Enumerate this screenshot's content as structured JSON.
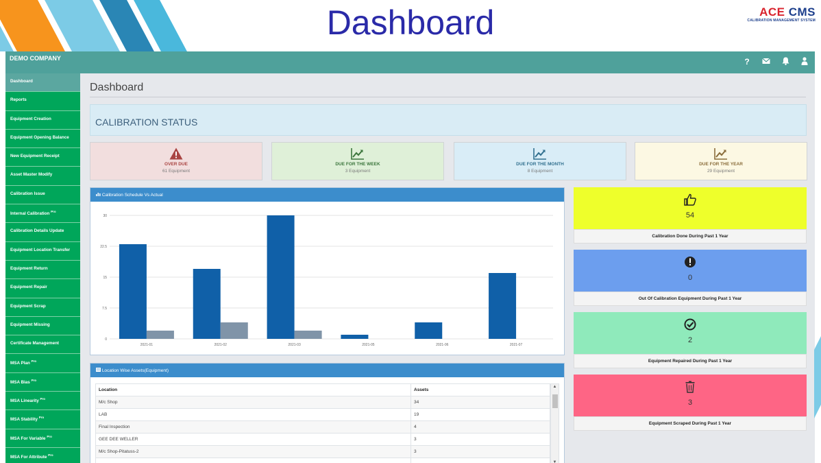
{
  "banner": {
    "title": "Dashboard",
    "logo_ace": "ACE",
    "logo_cms": "CMS",
    "logo_sub": "CALIBRATION MANAGEMENT SYSTEM"
  },
  "topbar": {
    "company": "DEMO COMPANY",
    "icons": [
      "help-icon",
      "mail-icon",
      "bell-icon",
      "user-icon"
    ],
    "help_glyph": "?"
  },
  "sidebar": {
    "items": [
      {
        "label": "Dashboard",
        "pro": ""
      },
      {
        "label": "Reports",
        "pro": ""
      },
      {
        "label": "Equipment Creation",
        "pro": ""
      },
      {
        "label": "Equipment Opening Balance",
        "pro": ""
      },
      {
        "label": "New Equipment Receipt",
        "pro": ""
      },
      {
        "label": "Asset Master Modify",
        "pro": ""
      },
      {
        "label": "Calibration Issue",
        "pro": ""
      },
      {
        "label": "Internal Calibration",
        "pro": "Pro"
      },
      {
        "label": "Calibration Details Update",
        "pro": ""
      },
      {
        "label": "Equipment Location Transfer",
        "pro": ""
      },
      {
        "label": "Equipment Return",
        "pro": ""
      },
      {
        "label": "Equipment Repair",
        "pro": ""
      },
      {
        "label": "Equipment Scrap",
        "pro": ""
      },
      {
        "label": "Equipment Missing",
        "pro": ""
      },
      {
        "label": "Certificate Management",
        "pro": ""
      },
      {
        "label": "MSA Plan",
        "pro": "Pro"
      },
      {
        "label": "MSA Bias",
        "pro": "Pro"
      },
      {
        "label": "MSA Linearity",
        "pro": "Pro"
      },
      {
        "label": "MSA Stability",
        "pro": "Pro"
      },
      {
        "label": "MSA For Variable",
        "pro": "Pro"
      },
      {
        "label": "MSA For Attribute",
        "pro": "Pro"
      }
    ]
  },
  "main": {
    "page_title": "Dashboard",
    "calibration_status": "CALIBRATION STATUS",
    "status_cards": [
      {
        "title": "OVER DUE",
        "sub": "61 Equipment",
        "icon": "warning-icon",
        "bg": "#f2dede",
        "color": "#a94442"
      },
      {
        "title": "DUE FOR THE WEEK",
        "sub": "3 Equipment",
        "icon": "trend-up-icon",
        "bg": "#dff0d8",
        "color": "#3c763d"
      },
      {
        "title": "DUE FOR THE MONTH",
        "sub": "8 Equipment",
        "icon": "trend-up-icon",
        "bg": "#d9edf7",
        "color": "#31708f"
      },
      {
        "title": "DUE FOR THE YEAR",
        "sub": "29 Equipment",
        "icon": "trend-up-icon",
        "bg": "#fcf8e3",
        "color": "#8a6d3b"
      }
    ],
    "chart_panel_title": "Calibration Schedule Vs Actual",
    "table_panel_title": "Location Wise Assets(Equipment)",
    "table": {
      "headers": [
        "Location",
        "Assets"
      ],
      "rows": [
        [
          "M/c Shop",
          "34"
        ],
        [
          "LAB",
          "19"
        ],
        [
          "Final Inspection",
          "4"
        ],
        [
          "GEE DEE WELLER",
          "3"
        ],
        [
          "M/c Shop-Pitatuss-2",
          "3"
        ]
      ]
    },
    "kpis": [
      {
        "value": "54",
        "label": "Calibration Done During Past 1 Year",
        "icon": "thumbs-up-icon",
        "bg": "#eeff2b"
      },
      {
        "value": "0",
        "label": "Out Of Calibration Equipment During Past 1 Year",
        "icon": "exclamation-circle-icon",
        "bg": "#6c9eee"
      },
      {
        "value": "2",
        "label": "Equipment Repaired During Past 1 Year",
        "icon": "check-circle-icon",
        "bg": "#8feabb"
      },
      {
        "value": "3",
        "label": "Equipment Scraped During Past 1 Year",
        "icon": "trash-icon",
        "bg": "#fe6585"
      }
    ]
  },
  "chart_data": {
    "type": "bar",
    "categories": [
      "2021-01",
      "2021-02",
      "2021-03",
      "2021-05",
      "2021-06",
      "2021-07"
    ],
    "series": [
      {
        "values": [
          23,
          17,
          30,
          1,
          4,
          16
        ],
        "color": "#1060a8"
      },
      {
        "values": [
          2,
          4,
          2,
          0,
          0,
          0
        ],
        "color": "#8094a8"
      }
    ],
    "yticks": [
      "0",
      "7.5",
      "15",
      "22.5",
      "30"
    ],
    "ylim": [
      0,
      30
    ],
    "grid": true,
    "xlabel": "",
    "ylabel": ""
  }
}
